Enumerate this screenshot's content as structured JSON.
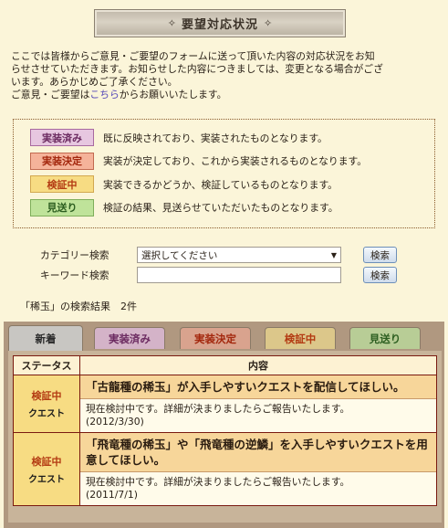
{
  "header": {
    "title": "要望対応状況",
    "ornament_left": "✧",
    "ornament_right": "✧"
  },
  "intro": {
    "line1": "ここでは皆様からご意見・ご要望のフォームに送って頂いた内容の対応状況をお知",
    "line2": "らせさせていただきます。お知らせした内容につきましては、変更となる場合がござ",
    "line3": "います。あらかじめご了承ください。",
    "line4_pre": "ご意見・ご要望は",
    "line4_link": "こちら",
    "line4_post": "からお願いいたします。"
  },
  "legend": [
    {
      "badge": "実装済み",
      "text": "既に反映されており、実装されたものとなります。"
    },
    {
      "badge": "実装決定",
      "text": "実装が決定しており、これから実装されるものとなります。"
    },
    {
      "badge": "検証中",
      "text": "実装できるかどうか、検証しているものとなります。"
    },
    {
      "badge": "見送り",
      "text": "検証の結果、見送らせていただいたものとなります。"
    }
  ],
  "search": {
    "category_label": "カテゴリー検索",
    "category_value": "選択してください",
    "keyword_label": "キーワード検索",
    "keyword_value": "",
    "button_label": "検索"
  },
  "results": {
    "title": "「稀玉」の検索結果　2件"
  },
  "tabs": [
    "新着",
    "実装済み",
    "実装決定",
    "検証中",
    "見送り"
  ],
  "table": {
    "headers": [
      "ステータス",
      "内容"
    ],
    "rows": [
      {
        "status": "検証中",
        "category": "クエスト",
        "title": "「古龍種の稀玉」が入手しやすいクエストを配信してほしい。",
        "body": "現在検討中です。詳細が決まりましたらご報告いたします。",
        "date": "(2012/3/30)"
      },
      {
        "status": "検証中",
        "category": "クエスト",
        "title1": "「飛竜種の稀玉」や「飛竜種の逆鱗」を入手しやすいクエストを用",
        "title2": "意してほしい。",
        "body": "現在検討中です。詳細が決まりましたらご報告いたします。",
        "date": "(2011/7/1)"
      }
    ]
  },
  "colors": {
    "background": "#fbf5d9",
    "border": "#7a1a10",
    "link": "#5548b8"
  }
}
